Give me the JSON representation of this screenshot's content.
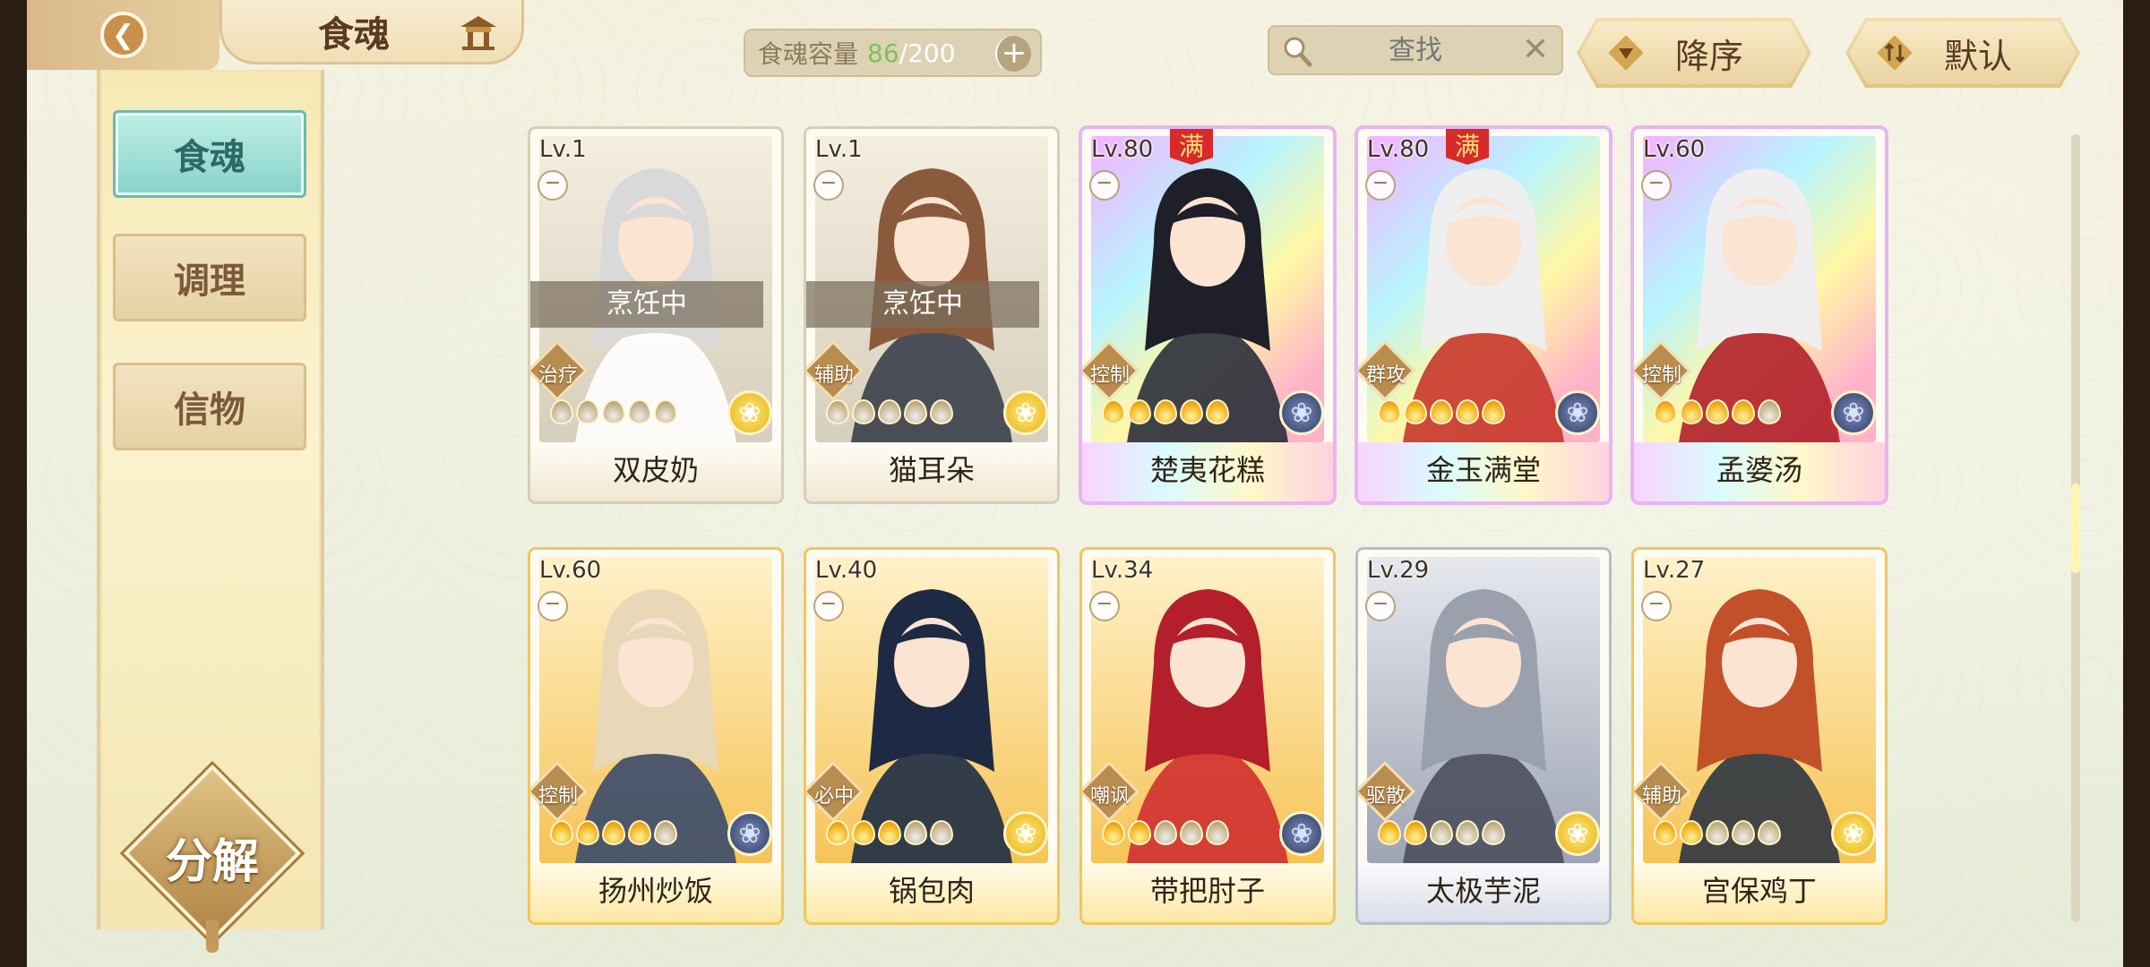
{
  "header": {
    "title": "食魂",
    "capacity": {
      "label": "食魂容量",
      "used": "86",
      "sep": "/",
      "total": "200"
    },
    "search": {
      "placeholder": "查找"
    },
    "sort_label": "降序",
    "default_label": "默认"
  },
  "sidebar": {
    "tabs": [
      {
        "label": "食魂",
        "active": true
      },
      {
        "label": "调理",
        "active": false
      },
      {
        "label": "信物",
        "active": false
      }
    ],
    "decompose_label": "分解"
  },
  "colors": {
    "accent_teal": "#86d3c9",
    "gold_frame": "#f2c65a",
    "max_badge": "#d72a2a",
    "capacity_used": "#7cc25a"
  },
  "cards": [
    {
      "level": "Lv.1",
      "name": "双皮奶",
      "role": "治疗",
      "status": "烹饪中",
      "max": "",
      "flames_lit": 0,
      "gem": "gold",
      "rarity": "plain"
    },
    {
      "level": "Lv.1",
      "name": "猫耳朵",
      "role": "辅助",
      "status": "烹饪中",
      "max": "",
      "flames_lit": 0,
      "gem": "gold",
      "rarity": "plain"
    },
    {
      "level": "Lv.80",
      "name": "楚夷花糕",
      "role": "控制",
      "status": "",
      "max": "满",
      "flames_lit": 5,
      "gem": "blue",
      "rarity": "rainbow"
    },
    {
      "level": "Lv.80",
      "name": "金玉满堂",
      "role": "群攻",
      "status": "",
      "max": "满",
      "flames_lit": 5,
      "gem": "blue",
      "rarity": "rainbow"
    },
    {
      "level": "Lv.60",
      "name": "孟婆汤",
      "role": "控制",
      "status": "",
      "max": "",
      "flames_lit": 4,
      "gem": "blue",
      "rarity": "rainbow"
    },
    {
      "level": "Lv.60",
      "name": "扬州炒饭",
      "role": "控制",
      "status": "",
      "max": "",
      "flames_lit": 4,
      "gem": "blue",
      "rarity": "gold"
    },
    {
      "level": "Lv.40",
      "name": "锅包肉",
      "role": "必中",
      "status": "",
      "max": "",
      "flames_lit": 3,
      "gem": "gold",
      "rarity": "gold"
    },
    {
      "level": "Lv.34",
      "name": "带把肘子",
      "role": "嘲讽",
      "status": "",
      "max": "",
      "flames_lit": 2,
      "gem": "blue",
      "rarity": "gold"
    },
    {
      "level": "Lv.29",
      "name": "太极芋泥",
      "role": "驱散",
      "status": "",
      "max": "",
      "flames_lit": 2,
      "gem": "gold",
      "rarity": "silver"
    },
    {
      "level": "Lv.27",
      "name": "宫保鸡丁",
      "role": "辅助",
      "status": "",
      "max": "",
      "flames_lit": 2,
      "gem": "gold",
      "rarity": "gold"
    }
  ]
}
